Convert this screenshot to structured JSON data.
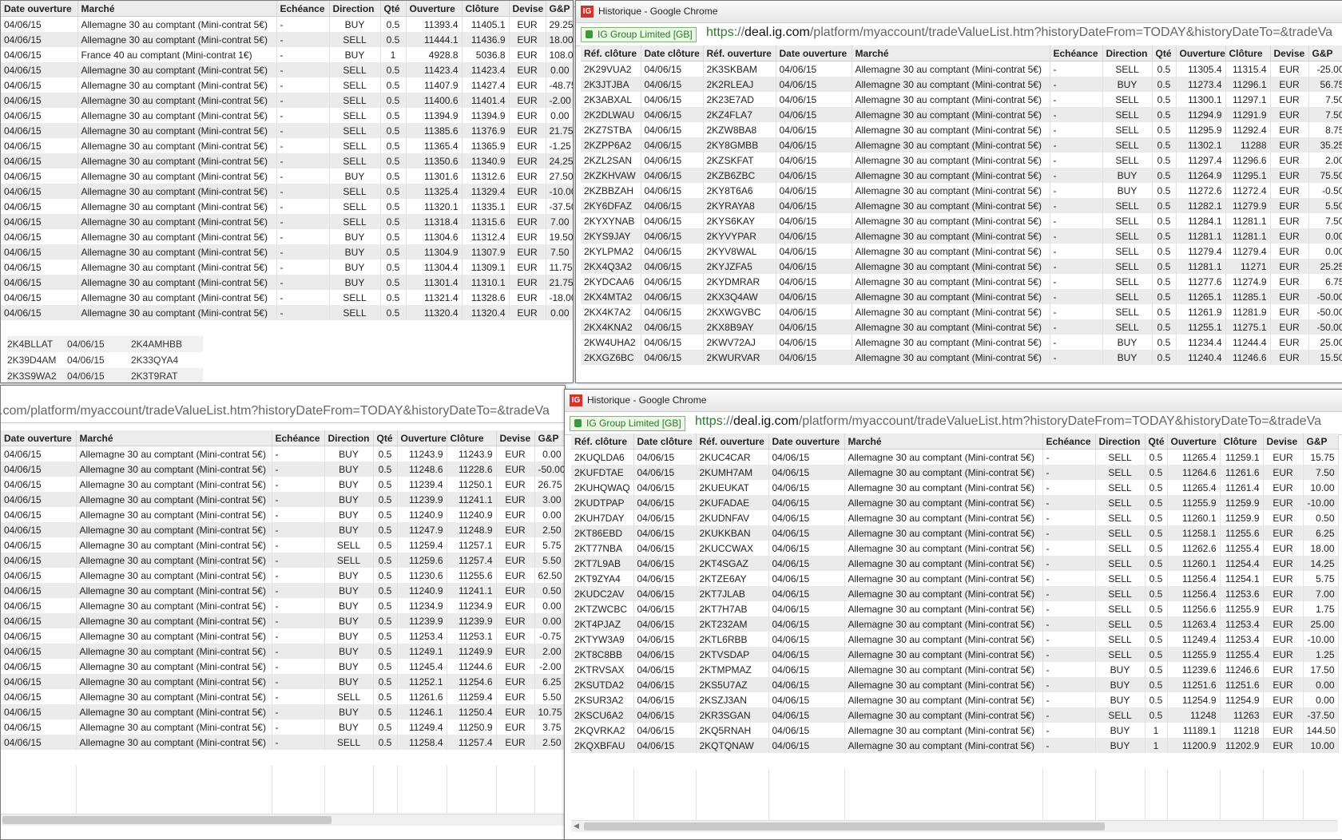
{
  "win_title": "Historique - Google Chrome",
  "ev_label": "IG Group Limited [GB]",
  "url_https": "https",
  "url_host": "deal.ig.com",
  "url_rest": "/platform/myaccount/tradeValueList.htm?historyDateFrom=TODAY&historyDateTo=&tradeVa",
  "url_partial": ".com/platform/myaccount/tradeValueList.htm?historyDateFrom=TODAY&historyDateTo=&tradeVa",
  "columns": {
    "ref_cloture": "Réf. clôture",
    "date_cloture": "Date clôture",
    "ref_ouverture": "Réf. ouverture",
    "date_ouverture": "Date ouverture",
    "marche": "Marché",
    "echeance": "Echéance",
    "direction": "Direction",
    "qte": "Qté",
    "ouverture": "Ouverture",
    "cloture": "Clôture",
    "devise": "Devise",
    "gp": "G&P"
  },
  "peek_rows": [
    [
      "2K4BLLAT",
      "04/06/15",
      "2K4AMHBB"
    ],
    [
      "2K39D4AM",
      "04/06/15",
      "2K33QYA4"
    ],
    [
      "2K3S9WA2",
      "04/06/15",
      "2K3T9RAT"
    ]
  ],
  "tl_rows": [
    [
      "04/06/15",
      "Allemagne 30 au comptant (Mini-contrat 5€)",
      "-",
      "BUY",
      "0.5",
      "11393.4",
      "11405.1",
      "EUR",
      "29.25"
    ],
    [
      "04/06/15",
      "Allemagne 30 au comptant (Mini-contrat 5€)",
      "-",
      "SELL",
      "0.5",
      "11444.1",
      "11436.9",
      "EUR",
      "18.00"
    ],
    [
      "04/06/15",
      "France 40 au comptant (Mini-contrat 1€)",
      "-",
      "BUY",
      "1",
      "4928.8",
      "5036.8",
      "EUR",
      "108.00"
    ],
    [
      "04/06/15",
      "Allemagne 30 au comptant (Mini-contrat 5€)",
      "-",
      "SELL",
      "0.5",
      "11423.4",
      "11423.4",
      "EUR",
      "0.00"
    ],
    [
      "04/06/15",
      "Allemagne 30 au comptant (Mini-contrat 5€)",
      "-",
      "SELL",
      "0.5",
      "11407.9",
      "11427.4",
      "EUR",
      "-48.75"
    ],
    [
      "04/06/15",
      "Allemagne 30 au comptant (Mini-contrat 5€)",
      "-",
      "SELL",
      "0.5",
      "11400.6",
      "11401.4",
      "EUR",
      "-2.00"
    ],
    [
      "04/06/15",
      "Allemagne 30 au comptant (Mini-contrat 5€)",
      "-",
      "SELL",
      "0.5",
      "11394.9",
      "11394.9",
      "EUR",
      "0.00"
    ],
    [
      "04/06/15",
      "Allemagne 30 au comptant (Mini-contrat 5€)",
      "-",
      "SELL",
      "0.5",
      "11385.6",
      "11376.9",
      "EUR",
      "21.75"
    ],
    [
      "04/06/15",
      "Allemagne 30 au comptant (Mini-contrat 5€)",
      "-",
      "SELL",
      "0.5",
      "11365.4",
      "11365.9",
      "EUR",
      "-1.25"
    ],
    [
      "04/06/15",
      "Allemagne 30 au comptant (Mini-contrat 5€)",
      "-",
      "SELL",
      "0.5",
      "11350.6",
      "11340.9",
      "EUR",
      "24.25"
    ],
    [
      "04/06/15",
      "Allemagne 30 au comptant (Mini-contrat 5€)",
      "-",
      "BUY",
      "0.5",
      "11301.6",
      "11312.6",
      "EUR",
      "27.50"
    ],
    [
      "04/06/15",
      "Allemagne 30 au comptant (Mini-contrat 5€)",
      "-",
      "SELL",
      "0.5",
      "11325.4",
      "11329.4",
      "EUR",
      "-10.00"
    ],
    [
      "04/06/15",
      "Allemagne 30 au comptant (Mini-contrat 5€)",
      "-",
      "SELL",
      "0.5",
      "11320.1",
      "11335.1",
      "EUR",
      "-37.50"
    ],
    [
      "04/06/15",
      "Allemagne 30 au comptant (Mini-contrat 5€)",
      "-",
      "SELL",
      "0.5",
      "11318.4",
      "11315.6",
      "EUR",
      "7.00"
    ],
    [
      "04/06/15",
      "Allemagne 30 au comptant (Mini-contrat 5€)",
      "-",
      "BUY",
      "0.5",
      "11304.6",
      "11312.4",
      "EUR",
      "19.50"
    ],
    [
      "04/06/15",
      "Allemagne 30 au comptant (Mini-contrat 5€)",
      "-",
      "BUY",
      "0.5",
      "11304.9",
      "11307.9",
      "EUR",
      "7.50"
    ],
    [
      "04/06/15",
      "Allemagne 30 au comptant (Mini-contrat 5€)",
      "-",
      "BUY",
      "0.5",
      "11304.4",
      "11309.1",
      "EUR",
      "11.75"
    ],
    [
      "04/06/15",
      "Allemagne 30 au comptant (Mini-contrat 5€)",
      "-",
      "BUY",
      "0.5",
      "11301.4",
      "11310.1",
      "EUR",
      "21.75"
    ],
    [
      "04/06/15",
      "Allemagne 30 au comptant (Mini-contrat 5€)",
      "-",
      "SELL",
      "0.5",
      "11321.4",
      "11328.6",
      "EUR",
      "-18.00"
    ],
    [
      "04/06/15",
      "Allemagne 30 au comptant (Mini-contrat 5€)",
      "-",
      "SELL",
      "0.5",
      "11320.4",
      "11320.4",
      "EUR",
      "0.00"
    ]
  ],
  "tr_rows": [
    [
      "2K29VUA2",
      "04/06/15",
      "2K3SKBAM",
      "04/06/15",
      "Allemagne 30 au comptant (Mini-contrat 5€)",
      "-",
      "SELL",
      "0.5",
      "11305.4",
      "11315.4",
      "EUR",
      "-25.00"
    ],
    [
      "2K3JTJBA",
      "04/06/15",
      "2K2RLEAJ",
      "04/06/15",
      "Allemagne 30 au comptant (Mini-contrat 5€)",
      "-",
      "BUY",
      "0.5",
      "11273.4",
      "11296.1",
      "EUR",
      "56.75"
    ],
    [
      "2K3ABXAL",
      "04/06/15",
      "2K23E7AD",
      "04/06/15",
      "Allemagne 30 au comptant (Mini-contrat 5€)",
      "-",
      "SELL",
      "0.5",
      "11300.1",
      "11297.1",
      "EUR",
      "7.50"
    ],
    [
      "2K2DLWAU",
      "04/06/15",
      "2KZ4FLA7",
      "04/06/15",
      "Allemagne 30 au comptant (Mini-contrat 5€)",
      "-",
      "SELL",
      "0.5",
      "11294.9",
      "11291.9",
      "EUR",
      "7.50"
    ],
    [
      "2KZ7STBA",
      "04/06/15",
      "2KZW8BA8",
      "04/06/15",
      "Allemagne 30 au comptant (Mini-contrat 5€)",
      "-",
      "SELL",
      "0.5",
      "11295.9",
      "11292.4",
      "EUR",
      "8.75"
    ],
    [
      "2KZPP6A2",
      "04/06/15",
      "2KY8GMBB",
      "04/06/15",
      "Allemagne 30 au comptant (Mini-contrat 5€)",
      "-",
      "SELL",
      "0.5",
      "11302.1",
      "11288",
      "EUR",
      "35.25"
    ],
    [
      "2KZL2SAN",
      "04/06/15",
      "2KZSKFAT",
      "04/06/15",
      "Allemagne 30 au comptant (Mini-contrat 5€)",
      "-",
      "SELL",
      "0.5",
      "11297.4",
      "11296.6",
      "EUR",
      "2.00"
    ],
    [
      "2KZKHVAW",
      "04/06/15",
      "2KZB6ZBC",
      "04/06/15",
      "Allemagne 30 au comptant (Mini-contrat 5€)",
      "-",
      "BUY",
      "0.5",
      "11264.9",
      "11295.1",
      "EUR",
      "75.50"
    ],
    [
      "2KZBBZAH",
      "04/06/15",
      "2KY8T6A6",
      "04/06/15",
      "Allemagne 30 au comptant (Mini-contrat 5€)",
      "-",
      "BUY",
      "0.5",
      "11272.6",
      "11272.4",
      "EUR",
      "-0.50"
    ],
    [
      "2KY6DFAZ",
      "04/06/15",
      "2KYRAYA8",
      "04/06/15",
      "Allemagne 30 au comptant (Mini-contrat 5€)",
      "-",
      "SELL",
      "0.5",
      "11282.1",
      "11279.9",
      "EUR",
      "5.50"
    ],
    [
      "2KYXYNAB",
      "04/06/15",
      "2KYS6KAY",
      "04/06/15",
      "Allemagne 30 au comptant (Mini-contrat 5€)",
      "-",
      "SELL",
      "0.5",
      "11284.1",
      "11281.1",
      "EUR",
      "7.50"
    ],
    [
      "2KYS9JAY",
      "04/06/15",
      "2KYVYPAR",
      "04/06/15",
      "Allemagne 30 au comptant (Mini-contrat 5€)",
      "-",
      "SELL",
      "0.5",
      "11281.1",
      "11281.1",
      "EUR",
      "0.00"
    ],
    [
      "2KYLPMA2",
      "04/06/15",
      "2KYV8WAL",
      "04/06/15",
      "Allemagne 30 au comptant (Mini-contrat 5€)",
      "-",
      "SELL",
      "0.5",
      "11279.4",
      "11279.4",
      "EUR",
      "0.00"
    ],
    [
      "2KX4Q3A2",
      "04/06/15",
      "2KYJZFA5",
      "04/06/15",
      "Allemagne 30 au comptant (Mini-contrat 5€)",
      "-",
      "SELL",
      "0.5",
      "11281.1",
      "11271",
      "EUR",
      "25.25"
    ],
    [
      "2KYDCAA6",
      "04/06/15",
      "2KYDMRAR",
      "04/06/15",
      "Allemagne 30 au comptant (Mini-contrat 5€)",
      "-",
      "SELL",
      "0.5",
      "11277.6",
      "11274.9",
      "EUR",
      "6.75"
    ],
    [
      "2KX4MTA2",
      "04/06/15",
      "2KX3Q4AW",
      "04/06/15",
      "Allemagne 30 au comptant (Mini-contrat 5€)",
      "-",
      "SELL",
      "0.5",
      "11265.1",
      "11285.1",
      "EUR",
      "-50.00"
    ],
    [
      "2KX4K7A2",
      "04/06/15",
      "2KXWGVBC",
      "04/06/15",
      "Allemagne 30 au comptant (Mini-contrat 5€)",
      "-",
      "SELL",
      "0.5",
      "11261.9",
      "11281.9",
      "EUR",
      "-50.00"
    ],
    [
      "2KX4KNA2",
      "04/06/15",
      "2KX8B9AY",
      "04/06/15",
      "Allemagne 30 au comptant (Mini-contrat 5€)",
      "-",
      "SELL",
      "0.5",
      "11255.1",
      "11275.1",
      "EUR",
      "-50.00"
    ],
    [
      "2KW4UHA2",
      "04/06/15",
      "2KWV72AJ",
      "04/06/15",
      "Allemagne 30 au comptant (Mini-contrat 5€)",
      "-",
      "BUY",
      "0.5",
      "11234.4",
      "11244.4",
      "EUR",
      "25.00"
    ],
    [
      "2KXGZ6BC",
      "04/06/15",
      "2KWURVAR",
      "04/06/15",
      "Allemagne 30 au comptant (Mini-contrat 5€)",
      "-",
      "BUY",
      "0.5",
      "11240.4",
      "11246.6",
      "EUR",
      "15.50"
    ]
  ],
  "bl_rows": [
    [
      "04/06/15",
      "Allemagne 30 au comptant (Mini-contrat 5€)",
      "-",
      "BUY",
      "0.5",
      "11243.9",
      "11243.9",
      "EUR",
      "0.00"
    ],
    [
      "04/06/15",
      "Allemagne 30 au comptant (Mini-contrat 5€)",
      "-",
      "BUY",
      "0.5",
      "11248.6",
      "11228.6",
      "EUR",
      "-50.00"
    ],
    [
      "04/06/15",
      "Allemagne 30 au comptant (Mini-contrat 5€)",
      "-",
      "BUY",
      "0.5",
      "11239.4",
      "11250.1",
      "EUR",
      "26.75"
    ],
    [
      "04/06/15",
      "Allemagne 30 au comptant (Mini-contrat 5€)",
      "-",
      "BUY",
      "0.5",
      "11239.9",
      "11241.1",
      "EUR",
      "3.00"
    ],
    [
      "04/06/15",
      "Allemagne 30 au comptant (Mini-contrat 5€)",
      "-",
      "BUY",
      "0.5",
      "11240.9",
      "11240.9",
      "EUR",
      "0.00"
    ],
    [
      "04/06/15",
      "Allemagne 30 au comptant (Mini-contrat 5€)",
      "-",
      "BUY",
      "0.5",
      "11247.9",
      "11248.9",
      "EUR",
      "2.50"
    ],
    [
      "04/06/15",
      "Allemagne 30 au comptant (Mini-contrat 5€)",
      "-",
      "SELL",
      "0.5",
      "11259.4",
      "11257.1",
      "EUR",
      "5.75"
    ],
    [
      "04/06/15",
      "Allemagne 30 au comptant (Mini-contrat 5€)",
      "-",
      "SELL",
      "0.5",
      "11259.6",
      "11257.4",
      "EUR",
      "5.50"
    ],
    [
      "04/06/15",
      "Allemagne 30 au comptant (Mini-contrat 5€)",
      "-",
      "BUY",
      "0.5",
      "11230.6",
      "11255.6",
      "EUR",
      "62.50"
    ],
    [
      "04/06/15",
      "Allemagne 30 au comptant (Mini-contrat 5€)",
      "-",
      "BUY",
      "0.5",
      "11240.9",
      "11241.1",
      "EUR",
      "0.50"
    ],
    [
      "04/06/15",
      "Allemagne 30 au comptant (Mini-contrat 5€)",
      "-",
      "BUY",
      "0.5",
      "11234.9",
      "11234.9",
      "EUR",
      "0.00"
    ],
    [
      "04/06/15",
      "Allemagne 30 au comptant (Mini-contrat 5€)",
      "-",
      "BUY",
      "0.5",
      "11239.9",
      "11239.9",
      "EUR",
      "0.00"
    ],
    [
      "04/06/15",
      "Allemagne 30 au comptant (Mini-contrat 5€)",
      "-",
      "BUY",
      "0.5",
      "11253.4",
      "11253.1",
      "EUR",
      "-0.75"
    ],
    [
      "04/06/15",
      "Allemagne 30 au comptant (Mini-contrat 5€)",
      "-",
      "BUY",
      "0.5",
      "11249.1",
      "11249.9",
      "EUR",
      "2.00"
    ],
    [
      "04/06/15",
      "Allemagne 30 au comptant (Mini-contrat 5€)",
      "-",
      "BUY",
      "0.5",
      "11245.4",
      "11244.6",
      "EUR",
      "-2.00"
    ],
    [
      "04/06/15",
      "Allemagne 30 au comptant (Mini-contrat 5€)",
      "-",
      "BUY",
      "0.5",
      "11252.1",
      "11254.6",
      "EUR",
      "6.25"
    ],
    [
      "04/06/15",
      "Allemagne 30 au comptant (Mini-contrat 5€)",
      "-",
      "SELL",
      "0.5",
      "11261.6",
      "11259.4",
      "EUR",
      "5.50"
    ],
    [
      "04/06/15",
      "Allemagne 30 au comptant (Mini-contrat 5€)",
      "-",
      "BUY",
      "0.5",
      "11246.1",
      "11250.4",
      "EUR",
      "10.75"
    ],
    [
      "04/06/15",
      "Allemagne 30 au comptant (Mini-contrat 5€)",
      "-",
      "BUY",
      "0.5",
      "11249.4",
      "11250.9",
      "EUR",
      "3.75"
    ],
    [
      "04/06/15",
      "Allemagne 30 au comptant (Mini-contrat 5€)",
      "-",
      "SELL",
      "0.5",
      "11258.4",
      "11257.4",
      "EUR",
      "2.50"
    ]
  ],
  "br_rows": [
    [
      "2KUQLDA6",
      "04/06/15",
      "2KUC4CAR",
      "04/06/15",
      "Allemagne 30 au comptant (Mini-contrat 5€)",
      "-",
      "SELL",
      "0.5",
      "11265.4",
      "11259.1",
      "EUR",
      "15.75"
    ],
    [
      "2KUFDTAE",
      "04/06/15",
      "2KUMH7AM",
      "04/06/15",
      "Allemagne 30 au comptant (Mini-contrat 5€)",
      "-",
      "SELL",
      "0.5",
      "11264.6",
      "11261.6",
      "EUR",
      "7.50"
    ],
    [
      "2KUHQWAQ",
      "04/06/15",
      "2KUEUKAT",
      "04/06/15",
      "Allemagne 30 au comptant (Mini-contrat 5€)",
      "-",
      "SELL",
      "0.5",
      "11265.4",
      "11261.4",
      "EUR",
      "10.00"
    ],
    [
      "2KUDTPAP",
      "04/06/15",
      "2KUFADAE",
      "04/06/15",
      "Allemagne 30 au comptant (Mini-contrat 5€)",
      "-",
      "SELL",
      "0.5",
      "11255.9",
      "11259.9",
      "EUR",
      "-10.00"
    ],
    [
      "2KUH7DAY",
      "04/06/15",
      "2KUDNFAV",
      "04/06/15",
      "Allemagne 30 au comptant (Mini-contrat 5€)",
      "-",
      "SELL",
      "0.5",
      "11260.1",
      "11259.9",
      "EUR",
      "0.50"
    ],
    [
      "2KT86EBD",
      "04/06/15",
      "2KUKKBAN",
      "04/06/15",
      "Allemagne 30 au comptant (Mini-contrat 5€)",
      "-",
      "SELL",
      "0.5",
      "11258.1",
      "11255.6",
      "EUR",
      "6.25"
    ],
    [
      "2KT77NBA",
      "04/06/15",
      "2KUCCWAX",
      "04/06/15",
      "Allemagne 30 au comptant (Mini-contrat 5€)",
      "-",
      "SELL",
      "0.5",
      "11262.6",
      "11255.4",
      "EUR",
      "18.00"
    ],
    [
      "2KT7L9AB",
      "04/06/15",
      "2KT4SGAZ",
      "04/06/15",
      "Allemagne 30 au comptant (Mini-contrat 5€)",
      "-",
      "SELL",
      "0.5",
      "11260.1",
      "11254.4",
      "EUR",
      "14.25"
    ],
    [
      "2KT9ZYA4",
      "04/06/15",
      "2KTZE6AY",
      "04/06/15",
      "Allemagne 30 au comptant (Mini-contrat 5€)",
      "-",
      "SELL",
      "0.5",
      "11256.4",
      "11254.1",
      "EUR",
      "5.75"
    ],
    [
      "2KUDC2AV",
      "04/06/15",
      "2KT7JLAB",
      "04/06/15",
      "Allemagne 30 au comptant (Mini-contrat 5€)",
      "-",
      "SELL",
      "0.5",
      "11256.4",
      "11253.6",
      "EUR",
      "7.00"
    ],
    [
      "2KTZWCBC",
      "04/06/15",
      "2KT7H7AB",
      "04/06/15",
      "Allemagne 30 au comptant (Mini-contrat 5€)",
      "-",
      "SELL",
      "0.5",
      "11256.6",
      "11255.9",
      "EUR",
      "1.75"
    ],
    [
      "2KT4PJAZ",
      "04/06/15",
      "2KT232AM",
      "04/06/15",
      "Allemagne 30 au comptant (Mini-contrat 5€)",
      "-",
      "SELL",
      "0.5",
      "11263.4",
      "11253.4",
      "EUR",
      "25.00"
    ],
    [
      "2KTYW3A9",
      "04/06/15",
      "2KTL6RBB",
      "04/06/15",
      "Allemagne 30 au comptant (Mini-contrat 5€)",
      "-",
      "SELL",
      "0.5",
      "11249.4",
      "11253.4",
      "EUR",
      "-10.00"
    ],
    [
      "2KT8C8BB",
      "04/06/15",
      "2KTVSDAP",
      "04/06/15",
      "Allemagne 30 au comptant (Mini-contrat 5€)",
      "-",
      "SELL",
      "0.5",
      "11255.9",
      "11255.4",
      "EUR",
      "1.25"
    ],
    [
      "2KTRVSAX",
      "04/06/15",
      "2KTMPMAZ",
      "04/06/15",
      "Allemagne 30 au comptant (Mini-contrat 5€)",
      "-",
      "BUY",
      "0.5",
      "11239.6",
      "11246.6",
      "EUR",
      "17.50"
    ],
    [
      "2KSUTDA2",
      "04/06/15",
      "2KS5U7AZ",
      "04/06/15",
      "Allemagne 30 au comptant (Mini-contrat 5€)",
      "-",
      "BUY",
      "0.5",
      "11251.6",
      "11251.6",
      "EUR",
      "0.00"
    ],
    [
      "2KSUR3A2",
      "04/06/15",
      "2KSZJ3AN",
      "04/06/15",
      "Allemagne 30 au comptant (Mini-contrat 5€)",
      "-",
      "BUY",
      "0.5",
      "11254.9",
      "11254.9",
      "EUR",
      "0.00"
    ],
    [
      "2KSCU6A2",
      "04/06/15",
      "2KR3SGAN",
      "04/06/15",
      "Allemagne 30 au comptant (Mini-contrat 5€)",
      "-",
      "SELL",
      "0.5",
      "11248",
      "11263",
      "EUR",
      "-37.50"
    ],
    [
      "2KQVRKA2",
      "04/06/15",
      "2KQ5RNAH",
      "04/06/15",
      "Allemagne 30 au comptant (Mini-contrat 5€)",
      "-",
      "BUY",
      "1",
      "11189.1",
      "11218",
      "EUR",
      "144.50"
    ],
    [
      "2KQXBFAU",
      "04/06/15",
      "2KQTQNAW",
      "04/06/15",
      "Allemagne 30 au comptant (Mini-contrat 5€)",
      "-",
      "BUY",
      "1",
      "11200.9",
      "11202.9",
      "EUR",
      "10.00"
    ]
  ]
}
